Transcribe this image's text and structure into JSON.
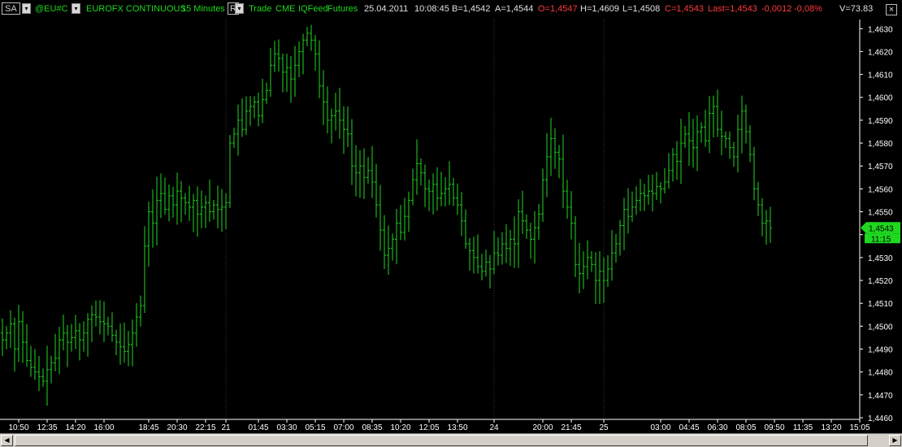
{
  "header": {
    "symbol_box": "SA",
    "symbol": "@EU#C",
    "instrument": "EUROFX CONTINUOUS",
    "interval": "15 Minutes",
    "r_box": "R",
    "fields": [
      "Trade",
      "CME",
      "IQFeed",
      "Futures"
    ],
    "date": "25.04.2011",
    "time": "10:08:45",
    "bid": "B=1,4542",
    "ask": "A=1,4544",
    "open": "O=1,4547",
    "high": "H=1,4609",
    "low": "L=1,4508",
    "close": "C=1,4543",
    "last": "Last=1,4543",
    "change": "-0,0012",
    "change_pct": "-0,08%",
    "volume": "V=73.83",
    "close_label": "×"
  },
  "colors": {
    "background": "#000000",
    "bars": "#1fd81f",
    "axis": "#ffffff",
    "price_label_bg": "#1fd81f",
    "negative": "#ff3a3a",
    "separator": "#3a3a3a"
  },
  "chart_data": {
    "type": "ohlc-bar",
    "ylim": [
      1.446,
      1.4634
    ],
    "yticks": [
      "1,4460",
      "1,4470",
      "1,4480",
      "1,4490",
      "1,4500",
      "1,4510",
      "1,4520",
      "1,4530",
      "1,4540",
      "1,4550",
      "1,4560",
      "1,4570",
      "1,4580",
      "1,4590",
      "1,4600",
      "1,4610",
      "1,4620",
      "1,4630"
    ],
    "ytick_values": [
      1.446,
      1.447,
      1.448,
      1.449,
      1.45,
      1.451,
      1.452,
      1.453,
      1.454,
      1.455,
      1.456,
      1.457,
      1.458,
      1.459,
      1.46,
      1.461,
      1.462,
      1.463
    ],
    "xticks": [
      {
        "label": "10:50",
        "index": 4
      },
      {
        "label": "12:35",
        "index": 11
      },
      {
        "label": "14:20",
        "index": 18
      },
      {
        "label": "16:00",
        "index": 25
      },
      {
        "label": "18:45",
        "index": 36
      },
      {
        "label": "20:30",
        "index": 43
      },
      {
        "label": "22:15",
        "index": 50
      },
      {
        "label": "21",
        "index": 55
      },
      {
        "label": "01:45",
        "index": 63
      },
      {
        "label": "03:30",
        "index": 70
      },
      {
        "label": "05:15",
        "index": 77
      },
      {
        "label": "07:00",
        "index": 84
      },
      {
        "label": "08:35",
        "index": 91
      },
      {
        "label": "10:20",
        "index": 98
      },
      {
        "label": "12:05",
        "index": 105
      },
      {
        "label": "13:50",
        "index": 112
      },
      {
        "label": "24",
        "index": 121
      },
      {
        "label": "20:00",
        "index": 133
      },
      {
        "label": "21:45",
        "index": 140
      },
      {
        "label": "25",
        "index": 148
      },
      {
        "label": "03:00",
        "index": 162
      },
      {
        "label": "04:45",
        "index": 169
      },
      {
        "label": "06:30",
        "index": 176
      },
      {
        "label": "08:05",
        "index": 183
      },
      {
        "label": "09:50",
        "index": 190
      },
      {
        "label": "11:35",
        "index": 197
      },
      {
        "label": "13:20",
        "index": 204
      },
      {
        "label": "15:05",
        "index": 211
      }
    ],
    "separators": [
      55,
      121,
      148
    ],
    "last_price_label": "1,4543",
    "last_price_value": 1.4543,
    "countdown_label": "11:15",
    "closes": [
      1.4494,
      1.4497,
      1.4501,
      1.449,
      1.4502,
      1.4493,
      1.4485,
      1.4482,
      1.448,
      1.4478,
      1.4476,
      1.4481,
      1.4484,
      1.4486,
      1.4494,
      1.4497,
      1.4493,
      1.4495,
      1.4498,
      1.4494,
      1.4497,
      1.4503,
      1.4505,
      1.4504,
      1.4502,
      1.4501,
      1.45,
      1.4496,
      1.4493,
      1.4491,
      1.4489,
      1.4492,
      1.4497,
      1.4504,
      1.4509,
      1.4535,
      1.455,
      1.4545,
      1.4555,
      1.4558,
      1.4551,
      1.4557,
      1.4553,
      1.4559,
      1.4556,
      1.4554,
      1.4552,
      1.4555,
      1.4549,
      1.4552,
      1.4554,
      1.455,
      1.4553,
      1.4551,
      1.4552,
      1.4554,
      1.458,
      1.4584,
      1.459,
      1.4586,
      1.4594,
      1.4596,
      1.4598,
      1.4592,
      1.4599,
      1.4603,
      1.4614,
      1.4619,
      1.4617,
      1.4611,
      1.4613,
      1.4608,
      1.4614,
      1.462,
      1.4625,
      1.4628,
      1.4625,
      1.4619,
      1.4605,
      1.4598,
      1.459,
      1.4592,
      1.4594,
      1.459,
      1.4586,
      1.4584,
      1.457,
      1.4567,
      1.457,
      1.4565,
      1.4568,
      1.4563,
      1.4553,
      1.4542,
      1.4531,
      1.4534,
      1.4538,
      1.4545,
      1.4541,
      1.4548,
      1.4555,
      1.4564,
      1.4571,
      1.4567,
      1.456,
      1.4559,
      1.4562,
      1.4556,
      1.4558,
      1.456,
      1.4562,
      1.4556,
      1.4553,
      1.4546,
      1.4536,
      1.4533,
      1.453,
      1.4526,
      1.4524,
      1.4528,
      1.4525,
      1.4532,
      1.4531,
      1.4536,
      1.4534,
      1.4538,
      1.4536,
      1.455,
      1.4546,
      1.4542,
      1.4538,
      1.4543,
      1.4549,
      1.4564,
      1.4574,
      1.4582,
      1.4576,
      1.4573,
      1.4559,
      1.4552,
      1.4545,
      1.4527,
      1.4523,
      1.4526,
      1.453,
      1.4527,
      1.452,
      1.4524,
      1.452,
      1.4525,
      1.4532,
      1.4536,
      1.4544,
      1.4551,
      1.4548,
      1.4552,
      1.4555,
      1.4558,
      1.4557,
      1.4559,
      1.4558,
      1.4561,
      1.456,
      1.4563,
      1.4568,
      1.4575,
      1.4572,
      1.458,
      1.4584,
      1.4581,
      1.4578,
      1.4585,
      1.4587,
      1.4581,
      1.4593,
      1.4596,
      1.4586,
      1.4583,
      1.4582,
      1.4578,
      1.4574,
      1.4586,
      1.4594,
      1.4585,
      1.4575,
      1.456,
      1.4553,
      1.4545,
      1.4546,
      1.4543
    ]
  }
}
